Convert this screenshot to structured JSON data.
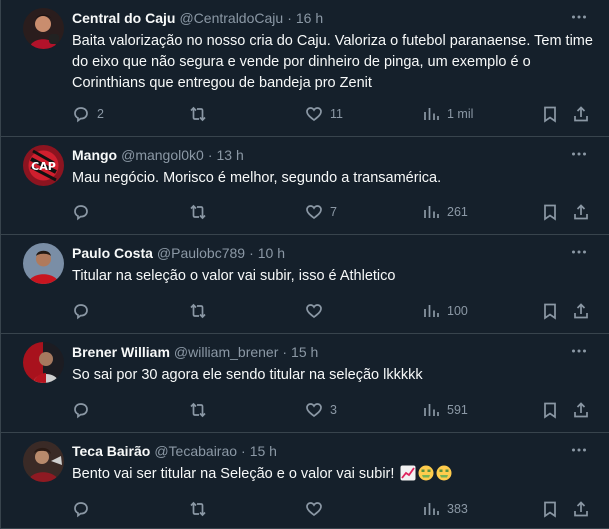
{
  "tweets": [
    {
      "name": "Central do Caju",
      "handle": "@CentraldoCaju",
      "separator": "·",
      "time": "16 h",
      "text": "Baita valorização no nosso cria do Caju. Valoriza o futebol paranaense. Tem time do eixo que não segura e vende por dinheiro de pinga, um exemplo é o Corinthians que entregou de bandeja pro Zenit",
      "replies": "2",
      "retweets": "",
      "likes": "11",
      "views": "1 mil"
    },
    {
      "name": "Mango",
      "handle": "@mangol0k0",
      "separator": "·",
      "time": "13 h",
      "text": "Mau negócio. Morisco é melhor, segundo a transamérica.",
      "replies": "",
      "retweets": "",
      "likes": "7",
      "views": "261"
    },
    {
      "name": "Paulo Costa",
      "handle": "@Paulobc789",
      "separator": "·",
      "time": "10 h",
      "text": "Titular na seleção o valor vai subir, isso é Athletico",
      "replies": "",
      "retweets": "",
      "likes": "",
      "views": "100"
    },
    {
      "name": "Brener William",
      "handle": "@william_brener",
      "separator": "·",
      "time": "15 h",
      "text": "So sai por 30 agora ele sendo titular na seleção lkkkkk",
      "replies": "",
      "retweets": "",
      "likes": "3",
      "views": "591"
    },
    {
      "name": "Teca Bairão",
      "handle": "@Tecabairao",
      "separator": "·",
      "time": "15 h",
      "text": "Bento vai ser titular na Seleção e o valor vai subir!",
      "emojis": [
        "chart-increasing-emoji",
        "money-mouth-face-emoji",
        "money-mouth-face-emoji"
      ],
      "replies": "",
      "retweets": "",
      "likes": "",
      "views": "383"
    }
  ],
  "colors": {
    "background": "#15202b",
    "border": "#38444d",
    "primary_text": "#f7f9f9",
    "secondary_text": "#8b98a5"
  },
  "icons": {
    "reply": "reply-icon",
    "retweet": "retweet-icon",
    "like": "like-icon",
    "views": "views-icon",
    "bookmark": "bookmark-icon",
    "share": "share-icon",
    "more": "more-icon"
  }
}
